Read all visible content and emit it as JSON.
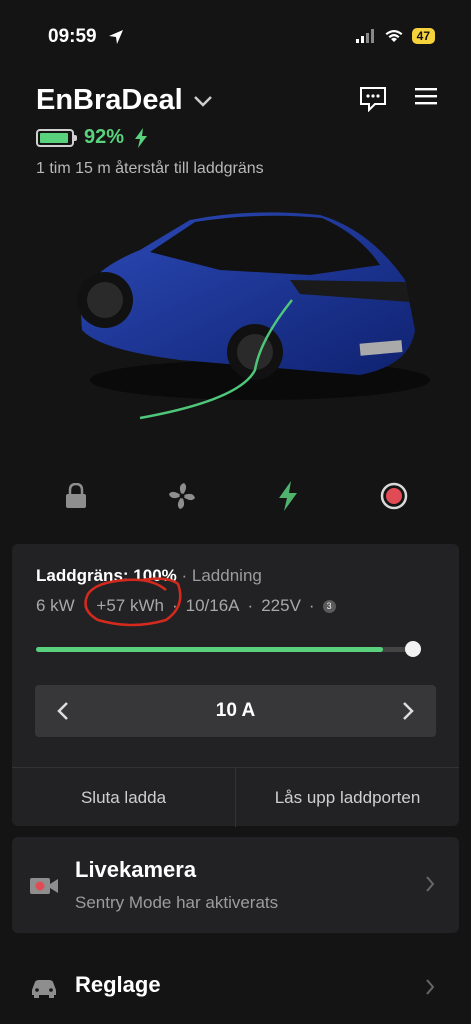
{
  "status_bar": {
    "time": "09:59",
    "battery": "47"
  },
  "header": {
    "vehicle_name": "EnBraDeal",
    "battery_pct": "92%",
    "battery_level": 0.92,
    "time_remaining": "1 tim 15 m återstår till laddgräns"
  },
  "quick_actions": [
    "lock-icon",
    "fan-icon",
    "charge-icon",
    "record-icon"
  ],
  "charging": {
    "limit_label": "Laddgräns: 100%",
    "status": "Laddning",
    "power": "6 kW",
    "energy_added": "+57 kWh",
    "current": "10/16A",
    "voltage": "225V",
    "phases": "3",
    "limit_level": 1.0,
    "amps": "10 A",
    "stop_button": "Sluta ladda",
    "unlock_port_button": "Lås upp laddporten"
  },
  "livecam": {
    "title": "Livekamera",
    "subtitle": "Sentry Mode har aktiverats"
  },
  "controls": {
    "title": "Reglage"
  },
  "colors": {
    "accent": "#5ad27d",
    "alert": "#e04b55",
    "annotation": "#d42a1e"
  }
}
